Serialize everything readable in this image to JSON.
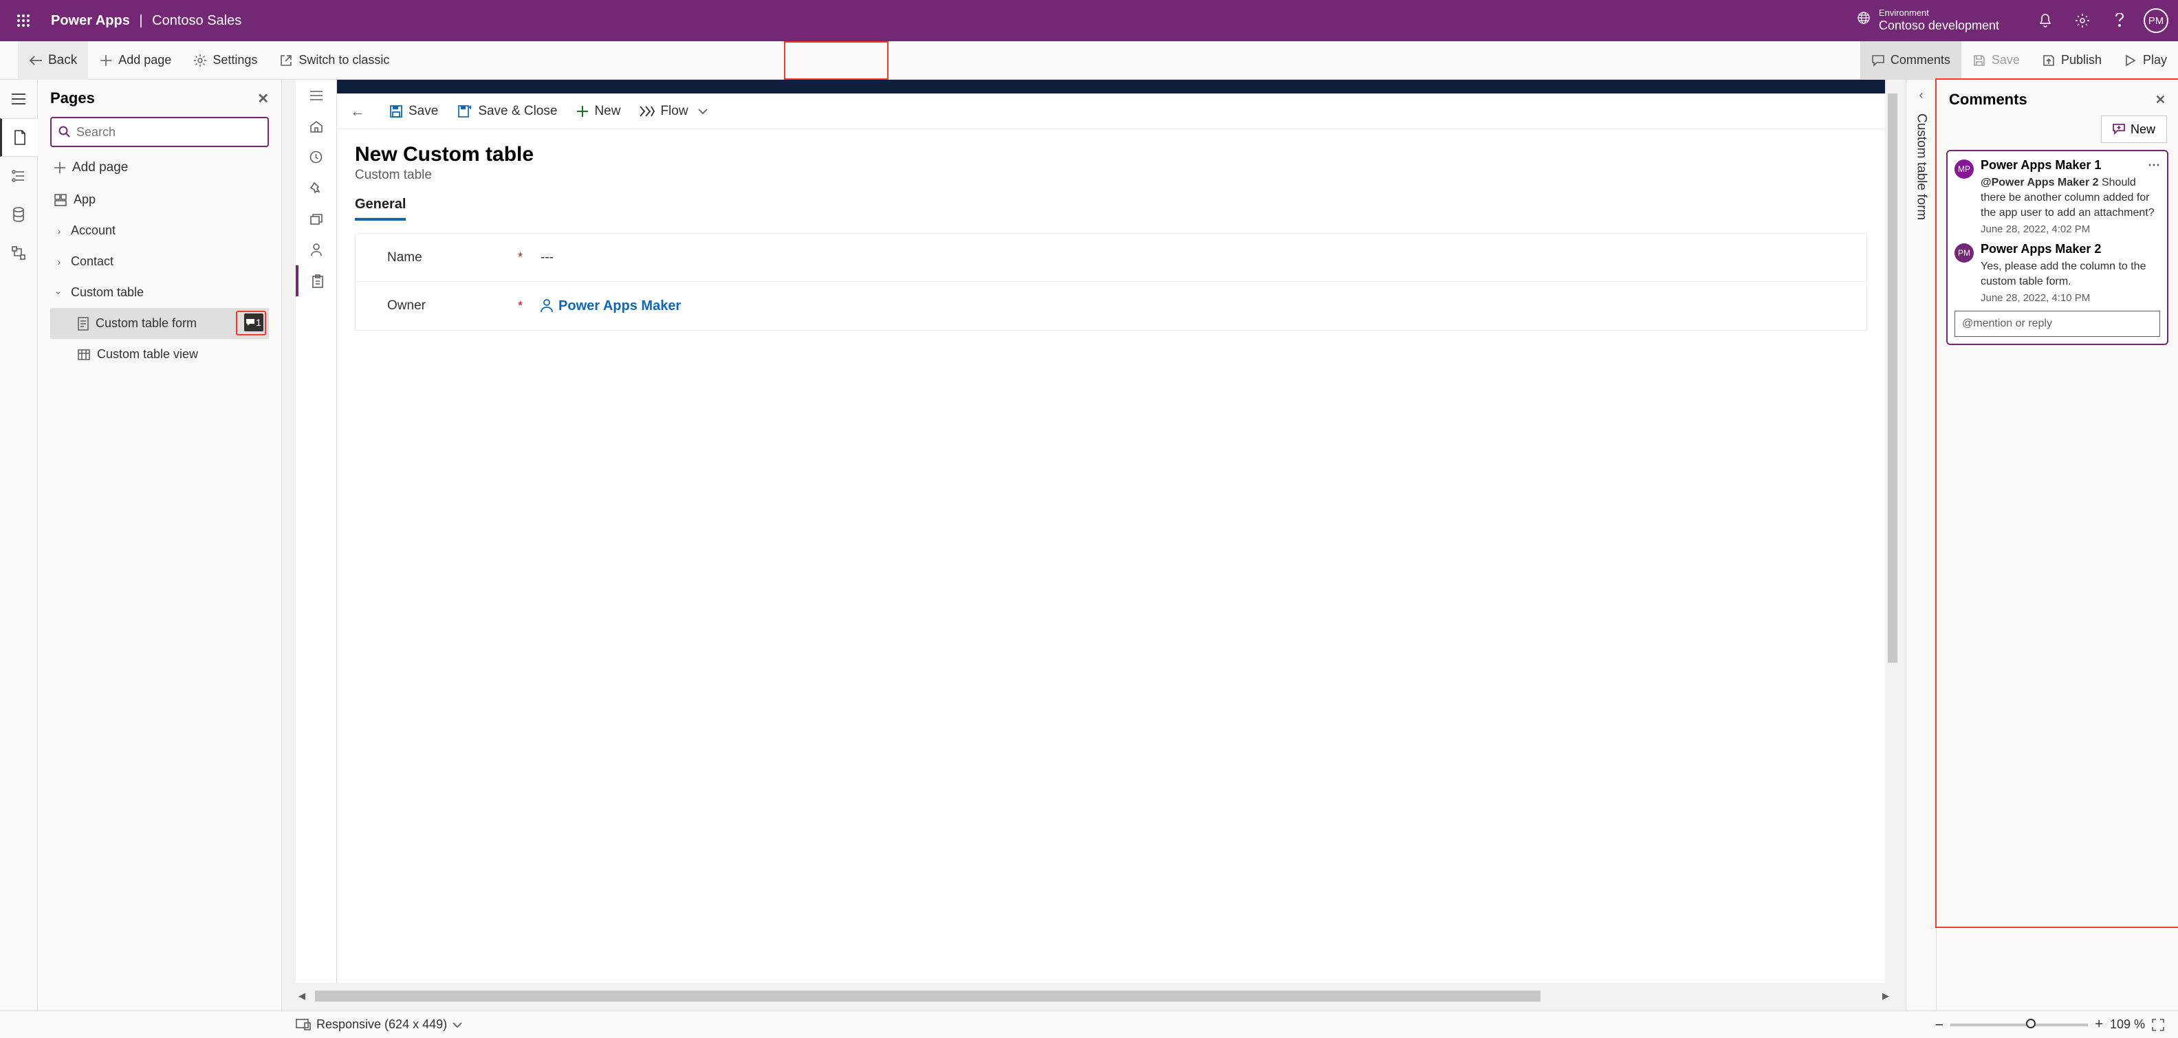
{
  "header": {
    "brand": "Power Apps",
    "app_name": "Contoso Sales",
    "env_label": "Environment",
    "env_name": "Contoso development",
    "avatar_initials": "PM"
  },
  "command_bar": {
    "back": "Back",
    "add_page": "Add page",
    "settings": "Settings",
    "switch": "Switch to classic",
    "comments": "Comments",
    "save": "Save",
    "publish": "Publish",
    "play": "Play"
  },
  "pages_panel": {
    "title": "Pages",
    "search_placeholder": "Search",
    "add_page": "Add page",
    "tree": {
      "app": "App",
      "account": "Account",
      "contact": "Contact",
      "custom_table": "Custom table",
      "custom_table_form": "Custom table form",
      "custom_table_view": "Custom table view",
      "badge_count": "1"
    }
  },
  "form_canvas": {
    "cmd_save": "Save",
    "cmd_save_close": "Save & Close",
    "cmd_new": "New",
    "cmd_flow": "Flow",
    "title": "New Custom table",
    "subtitle": "Custom table",
    "tab_general": "General",
    "field_name_label": "Name",
    "field_name_value": "---",
    "field_owner_label": "Owner",
    "field_owner_value": "Power Apps Maker"
  },
  "right_tab": {
    "label": "Custom table form"
  },
  "comments_panel": {
    "title": "Comments",
    "new_btn": "New",
    "entries": [
      {
        "initials": "MP",
        "author": "Power Apps Maker 1",
        "mention": "@Power Apps Maker 2",
        "text": "Should there be another column added for the app user to add an attachment?",
        "timestamp": "June 28, 2022, 4:02 PM"
      },
      {
        "initials": "PM",
        "author": "Power Apps Maker 2",
        "text": "Yes, please add the column to the custom table form.",
        "timestamp": "June 28, 2022, 4:10 PM"
      }
    ],
    "reply_placeholder": "@mention or reply"
  },
  "status_bar": {
    "responsive": "Responsive (624 x 449)",
    "zoom": "109 %"
  }
}
